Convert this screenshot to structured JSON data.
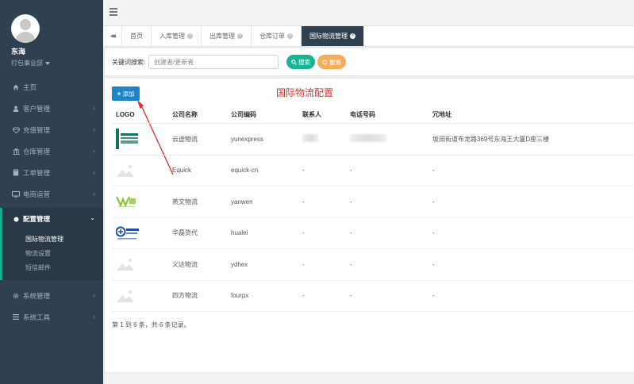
{
  "sidebar": {
    "user_name": "东海",
    "user_dept": "打包事业部",
    "items": [
      {
        "label": "主页",
        "icon": "home-icon",
        "chevron": false
      },
      {
        "label": "客户管理",
        "icon": "user-icon",
        "chevron": true
      },
      {
        "label": "充值管理",
        "icon": "diamond-icon",
        "chevron": true
      },
      {
        "label": "仓库管理",
        "icon": "bank-icon",
        "chevron": true
      },
      {
        "label": "工单管理",
        "icon": "book-icon",
        "chevron": true
      },
      {
        "label": "电商运营",
        "icon": "monitor-icon",
        "chevron": true
      },
      {
        "label": "配置管理",
        "icon": "dot-icon",
        "chevron": true,
        "active": true
      },
      {
        "label": "系统管理",
        "icon": "gear-icon",
        "chevron": true
      },
      {
        "label": "系统工具",
        "icon": "list-icon",
        "chevron": true
      }
    ],
    "submenu": [
      "国际物流管理",
      "物流设置",
      "短信邮件"
    ]
  },
  "tabs": {
    "back_glyph": "◀◀",
    "items": [
      {
        "label": "首页",
        "closable": false
      },
      {
        "label": "入库管理",
        "closable": true
      },
      {
        "label": "出库管理",
        "closable": true
      },
      {
        "label": "仓库订单",
        "closable": true
      },
      {
        "label": "国际物流管理",
        "closable": true,
        "active": true
      }
    ]
  },
  "search": {
    "label": "关键词搜索:",
    "placeholder": "创建者/更新者",
    "search_btn": "搜索",
    "reset_btn": "重置"
  },
  "toolbar": {
    "add_label": "添加",
    "annotation": "国际物流配置"
  },
  "table": {
    "headers": [
      "LOGO",
      "公司名称",
      "公司编码",
      "联系人",
      "电话号码",
      "冗地址"
    ],
    "rows": [
      {
        "logo": "yunexpress",
        "name": "云途物流",
        "code": "yunexpress",
        "contact": "",
        "phone": "",
        "address": "坂田街道布龙路369号东海王大厦D座三楼"
      },
      {
        "logo": "placeholder",
        "name": "Equick",
        "code": "equick-cn",
        "contact": "-",
        "phone": "-",
        "address": "-"
      },
      {
        "logo": "yanwen",
        "name": "燕文物流",
        "code": "yanwen",
        "contact": "-",
        "phone": "-",
        "address": "-"
      },
      {
        "logo": "hualei",
        "name": "华磊货代",
        "code": "hualei",
        "contact": "-",
        "phone": "-",
        "address": "-"
      },
      {
        "logo": "placeholder",
        "name": "义达物流",
        "code": "ydhex",
        "contact": "-",
        "phone": "-",
        "address": "-"
      },
      {
        "logo": "placeholder",
        "name": "四方物流",
        "code": "fourpx",
        "contact": "-",
        "phone": "-",
        "address": "-"
      }
    ]
  },
  "pagination": {
    "summary": "第 1 到 6 条，共 6 条记录。"
  },
  "colors": {
    "sidebar_bg": "#2f4050",
    "accent_green": "#1ab394",
    "accent_orange": "#f8ac59",
    "accent_blue": "#1c84c6",
    "annotation_red": "#e02b2b"
  }
}
